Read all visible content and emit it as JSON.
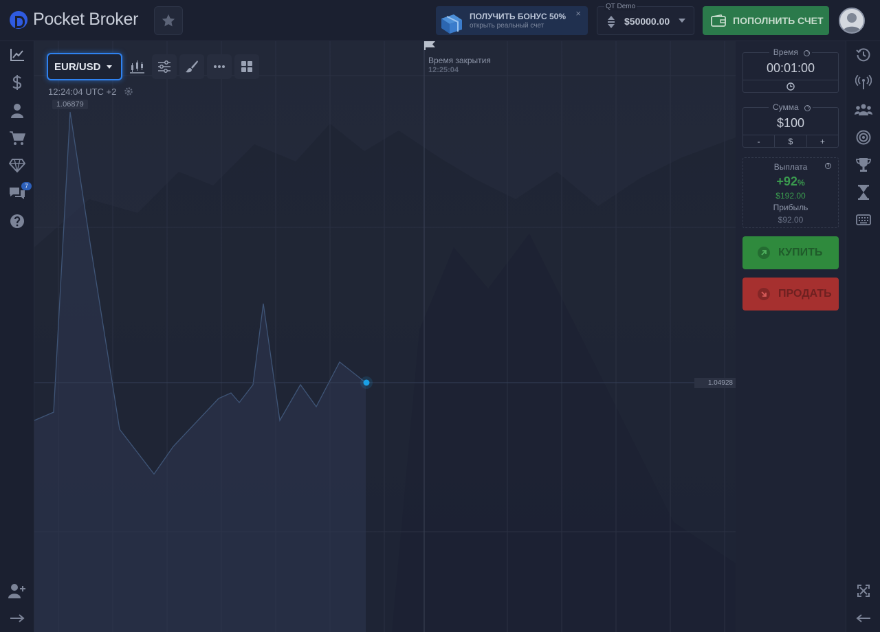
{
  "header": {
    "logo_text": "Pocket Broker",
    "bonus_title": "ПОЛУЧИТЬ БОНУС 50%",
    "bonus_subtitle": "открыть реальный счет",
    "bonus_close": "×",
    "account_label": "QT Demo",
    "balance": "$50000.00",
    "deposit_label": "ПОПОЛНИТЬ СЧЕТ"
  },
  "left_sidebar": {
    "icons": [
      "chart-line-icon",
      "dollar-icon",
      "user-icon",
      "cart-icon",
      "diamond-icon",
      "chat-icon",
      "help-icon",
      "add-user-icon",
      "arrow-right-icon"
    ],
    "chat_badge": "7"
  },
  "right_sidebar": {
    "icons": [
      "history-icon",
      "signal-icon",
      "social-icon",
      "target-icon",
      "trophy-icon",
      "hourglass-icon",
      "keyboard-icon",
      "fullscreen-icon",
      "arrow-left-icon"
    ]
  },
  "chart": {
    "pair": "EUR/USD",
    "clock": "12:24:04 UTC +2",
    "high_label": "1.06879",
    "close_title": "Время закрытия",
    "close_time": "12:25:04",
    "current_price": "1.04928"
  },
  "panel": {
    "time_label": "Время",
    "time_value": "00:01:00",
    "amount_label": "Сумма",
    "amount_value": "$100",
    "minus": "-",
    "currency": "$",
    "plus": "+",
    "payout_label": "Выплата",
    "payout_percent": "+92",
    "percent_sign": "%",
    "payout_amount": "$192.00",
    "profit_label": "Прибыль",
    "profit_amount": "$92.00",
    "buy_label": "КУПИТЬ",
    "sell_label": "ПРОДАТЬ"
  },
  "colors": {
    "accent_blue": "#2f82f0",
    "buy_green": "#2f8a3d",
    "sell_red": "#a6302f",
    "deposit_green": "#2b7a4b",
    "payout_green": "#3a9a4e"
  }
}
